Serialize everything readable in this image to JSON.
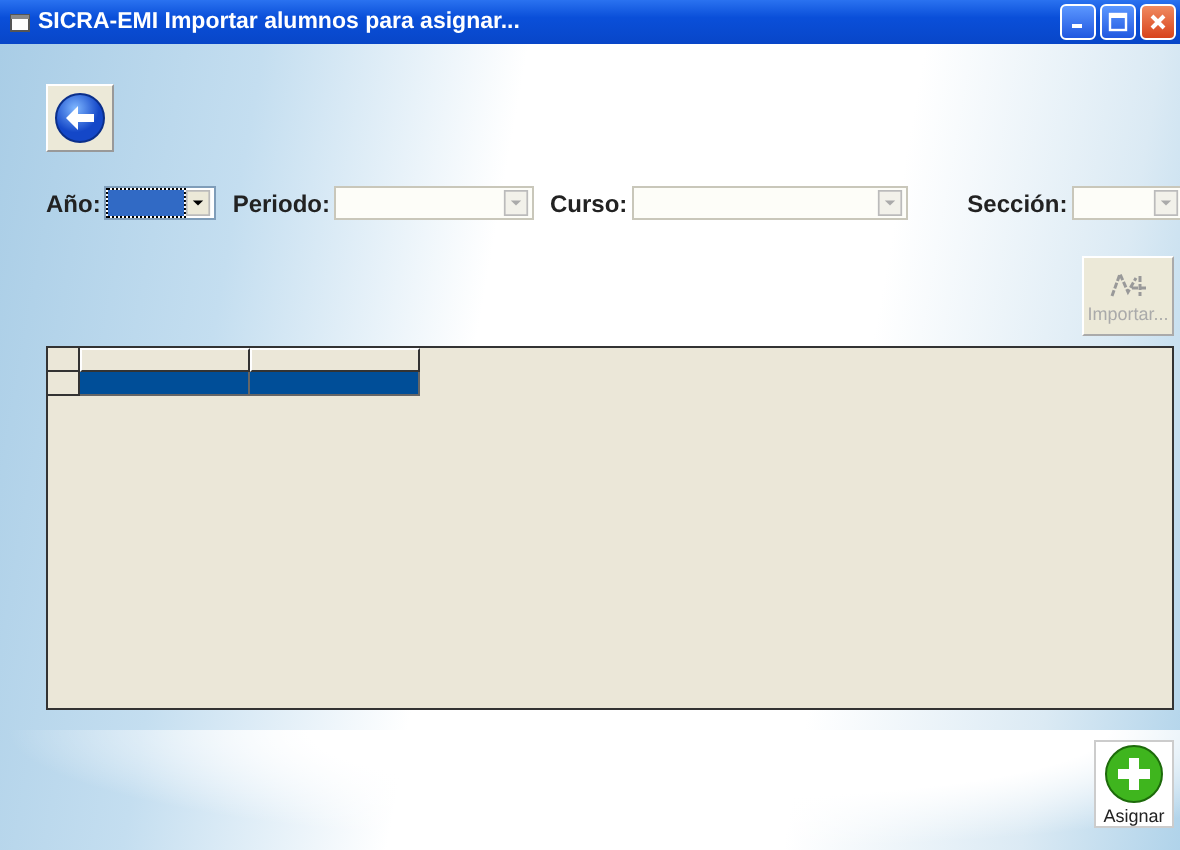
{
  "window": {
    "title": "SICRA-EMI Importar alumnos para asignar..."
  },
  "filters": [
    {
      "label": "Año:",
      "focused": true,
      "disabled": false
    },
    {
      "label": "Periodo:",
      "focused": false,
      "disabled": true
    },
    {
      "label": "Curso:",
      "focused": false,
      "disabled": true
    },
    {
      "label": "Sección:",
      "focused": false,
      "disabled": true
    }
  ],
  "import_button": {
    "label": "Importar...",
    "disabled": true
  },
  "grid": {
    "rows": [
      {
        "selected": true
      }
    ]
  },
  "assign_button": {
    "label": "Asignar"
  }
}
